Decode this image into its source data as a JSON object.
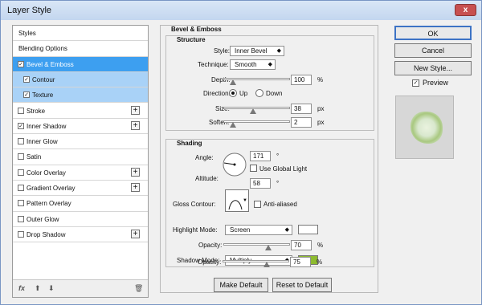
{
  "window": {
    "title": "Layer Style",
    "close_glyph": "x"
  },
  "sidebar": {
    "items": [
      {
        "label": "Styles",
        "checked": false,
        "has_plus": false
      },
      {
        "label": "Blending Options",
        "checked": false,
        "has_plus": false
      },
      {
        "label": "Bevel & Emboss",
        "checked": true,
        "has_plus": false
      },
      {
        "label": "Contour",
        "checked": true,
        "has_plus": false
      },
      {
        "label": "Texture",
        "checked": true,
        "has_plus": false
      },
      {
        "label": "Stroke",
        "checked": false,
        "has_plus": true
      },
      {
        "label": "Inner Shadow",
        "checked": true,
        "has_plus": true
      },
      {
        "label": "Inner Glow",
        "checked": false,
        "has_plus": false
      },
      {
        "label": "Satin",
        "checked": false,
        "has_plus": false
      },
      {
        "label": "Color Overlay",
        "checked": false,
        "has_plus": true
      },
      {
        "label": "Gradient Overlay",
        "checked": false,
        "has_plus": true
      },
      {
        "label": "Pattern Overlay",
        "checked": false,
        "has_plus": false
      },
      {
        "label": "Outer Glow",
        "checked": false,
        "has_plus": false
      },
      {
        "label": "Drop Shadow",
        "checked": false,
        "has_plus": true
      }
    ],
    "footer": {
      "fx": "fx",
      "up": "⬆",
      "down": "⬇",
      "trash": "🗑"
    }
  },
  "bevel": {
    "heading": "Bevel & Emboss",
    "structure_heading": "Structure",
    "style_label": "Style:",
    "style_value": "Inner Bevel",
    "technique_label": "Technique:",
    "technique_value": "Smooth",
    "depth_label": "Depth:",
    "depth_value": "100",
    "depth_unit": "%",
    "direction_label": "Direction:",
    "direction_up": "Up",
    "direction_down": "Down",
    "size_label": "Size:",
    "size_value": "38",
    "size_unit": "px",
    "soften_label": "Soften:",
    "soften_value": "2",
    "soften_unit": "px"
  },
  "shading": {
    "heading": "Shading",
    "angle_label": "Angle:",
    "angle_value": "171",
    "angle_unit": "°",
    "global_light_label": "Use Global Light",
    "altitude_label": "Altitude:",
    "altitude_value": "58",
    "altitude_unit": "°",
    "gloss_contour_label": "Gloss Contour:",
    "anti_aliased_label": "Anti-aliased",
    "highlight_mode_label": "Highlight Mode:",
    "highlight_mode_value": "Screen",
    "highlight_color": "#ffffff",
    "highlight_opacity_label": "Opacity:",
    "highlight_opacity_value": "70",
    "highlight_opacity_unit": "%",
    "shadow_mode_label": "Shadow Mode:",
    "shadow_mode_value": "Multiply",
    "shadow_color": "#8dbb2f",
    "shadow_opacity_label": "Opacity:",
    "shadow_opacity_value": "75",
    "shadow_opacity_unit": "%"
  },
  "actions": {
    "make_default": "Make Default",
    "reset_default": "Reset to Default",
    "ok": "OK",
    "cancel": "Cancel",
    "new_style": "New Style...",
    "preview_label": "Preview"
  }
}
